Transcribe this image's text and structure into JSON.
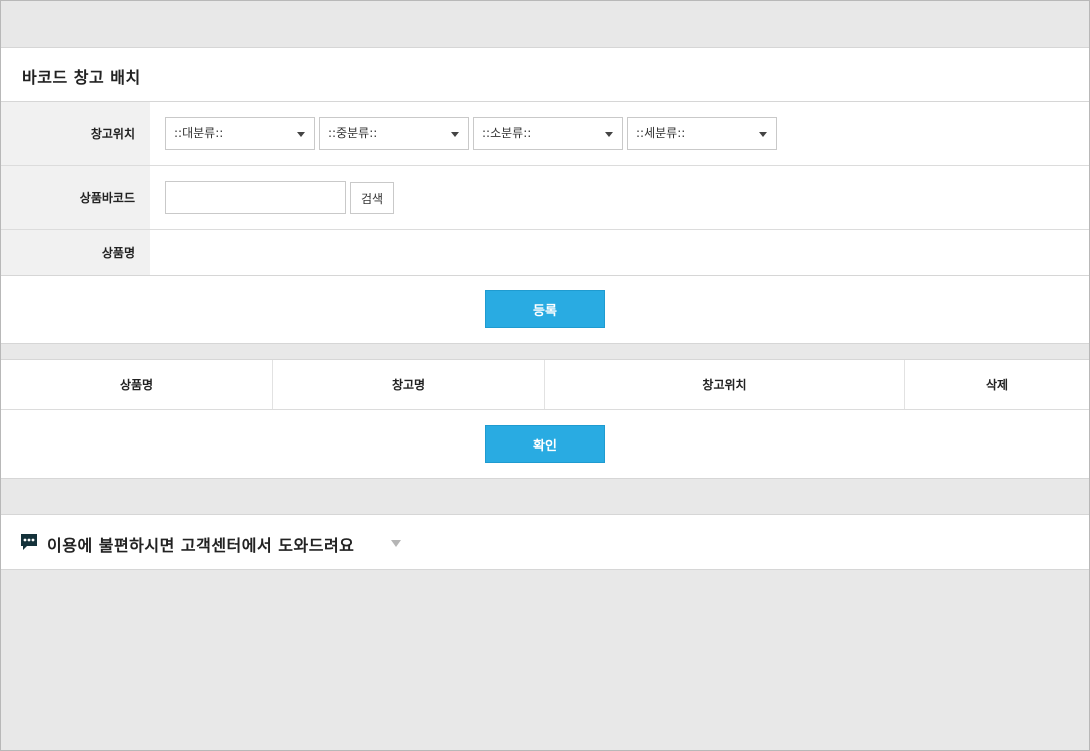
{
  "page": {
    "title": "바코드 창고 배치"
  },
  "form": {
    "location_label": "창고위치",
    "categories": [
      {
        "selected": "::대분류::"
      },
      {
        "selected": "::중분류::"
      },
      {
        "selected": "::소분류::"
      },
      {
        "selected": "::세분류::"
      }
    ],
    "barcode_label": "상품바코드",
    "barcode_value": "",
    "search_label": "검색",
    "product_name_label": "상품명",
    "product_name_value": ""
  },
  "actions": {
    "register_label": "등록",
    "confirm_label": "확인"
  },
  "list": {
    "columns": [
      "상품명",
      "창고명",
      "창고위치",
      "삭제"
    ]
  },
  "help": {
    "text": "이용에 불편하시면 고객센터에서 도와드려요"
  },
  "colors": {
    "primary": "#29abe2",
    "chat_icon": "#14323a"
  }
}
